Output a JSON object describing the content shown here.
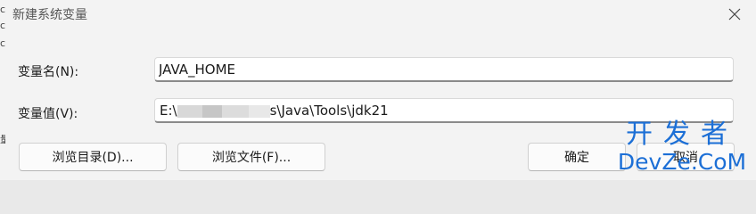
{
  "dialog": {
    "title": "新建系统变量",
    "fields": [
      {
        "label": "变量名(N):",
        "value": "JAVA_HOME"
      },
      {
        "label": "变量值(V):",
        "value_prefix": "E:\\",
        "value_suffix": "s\\Java\\Tools\\jdk21"
      }
    ],
    "buttons": {
      "browse_dir": "浏览目录(D)...",
      "browse_file": "浏览文件(F)...",
      "ok": "确定",
      "cancel": "取消"
    }
  },
  "background_chars": [
    "c",
    "c",
    "c",
    "量"
  ],
  "watermark": {
    "cn": "开发者",
    "en": "DevZe.CoM"
  },
  "colors": {
    "dialog_bg": "#f3f3f3",
    "watermark": "#1c6fd6"
  },
  "icons": {
    "close": "close-icon"
  }
}
